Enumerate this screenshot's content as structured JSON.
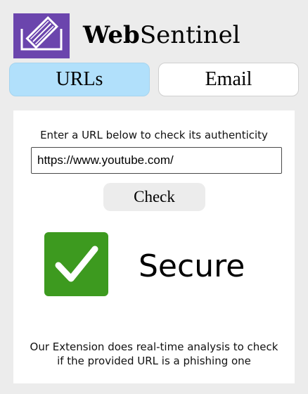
{
  "app": {
    "brand_bold": "Web",
    "brand_rest": "Sentinel",
    "logo_icon": "document-pen-icon",
    "logo_color": "#6b45ad"
  },
  "tabs": [
    {
      "label": "URLs",
      "active": true,
      "color": "#b1e0fb"
    },
    {
      "label": "Email",
      "active": false,
      "color": "#ffffff"
    }
  ],
  "url_check": {
    "instruction": "Enter a URL below to check its authenticity",
    "input_value": "https://www.youtube.com/",
    "check_label": "Check"
  },
  "result": {
    "icon": "checkmark-icon",
    "icon_color": "#3d9a1f",
    "status": "Secure"
  },
  "footer": {
    "line1": "Our Extension does real-time analysis to check",
    "line2": "if the provided URL is a phishing one"
  }
}
